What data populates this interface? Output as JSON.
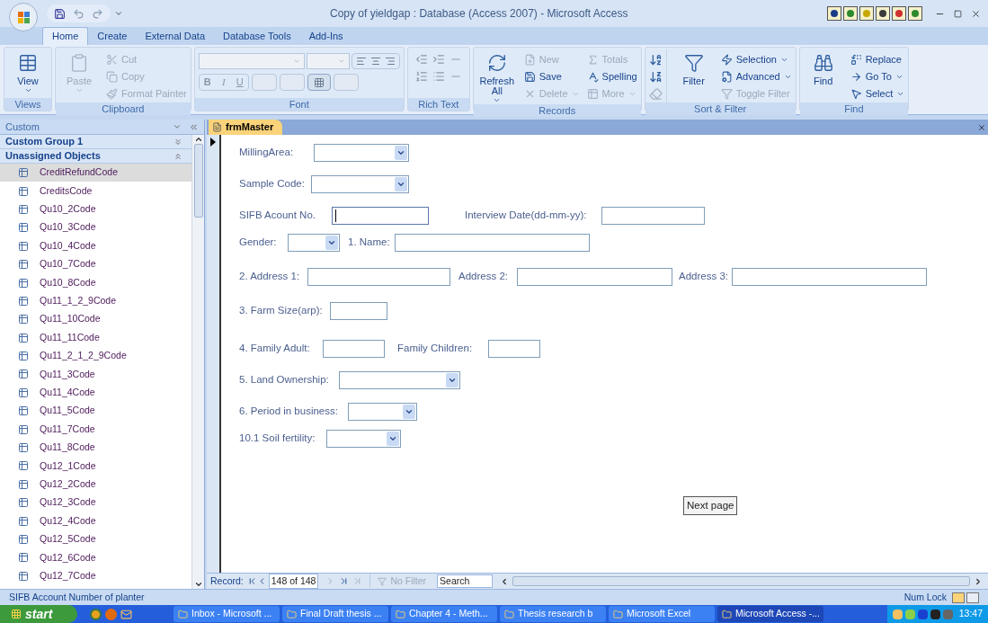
{
  "window": {
    "title": "Copy of yieldgap : Database (Access 2007) - Microsoft Access"
  },
  "ribbon_tabs": [
    {
      "label": "Home",
      "selected": true
    },
    {
      "label": "Create",
      "selected": false
    },
    {
      "label": "External Data",
      "selected": false
    },
    {
      "label": "Database Tools",
      "selected": false
    },
    {
      "label": "Add-Ins",
      "selected": false
    }
  ],
  "ribbon_groups": [
    {
      "kind": "commands",
      "label": "Views",
      "items": [
        {
          "label": "View",
          "kind": "large",
          "disabled": false,
          "dropdown": true
        }
      ]
    },
    {
      "kind": "commands",
      "label": "Clipboard",
      "items": [
        {
          "label": "Paste",
          "kind": "large",
          "disabled": true,
          "dropdown": true
        },
        {
          "label": "Cut",
          "kind": "small",
          "disabled": true,
          "dropdown": false
        },
        {
          "label": "Copy",
          "kind": "small",
          "disabled": true,
          "dropdown": false
        },
        {
          "label": "Format Painter",
          "kind": "small",
          "disabled": true,
          "dropdown": false
        }
      ]
    },
    {
      "kind": "font",
      "label": "Font",
      "format_buttons": [
        "B",
        "I",
        "U"
      ]
    },
    {
      "kind": "richtext",
      "label": "Rich Text"
    },
    {
      "kind": "commands",
      "label": "Records",
      "items": [
        {
          "label": "Refresh All",
          "kind": "large",
          "disabled": false,
          "dropdown": true
        },
        {
          "label": "New",
          "kind": "small",
          "disabled": true,
          "dropdown": false
        },
        {
          "label": "Save",
          "kind": "small",
          "disabled": false,
          "dropdown": false
        },
        {
          "label": "Delete",
          "kind": "small",
          "disabled": true,
          "dropdown": true
        },
        {
          "label": "Totals",
          "kind": "small",
          "disabled": true,
          "dropdown": false
        },
        {
          "label": "Spelling",
          "kind": "small",
          "disabled": false,
          "dropdown": false
        },
        {
          "label": "More",
          "kind": "small",
          "disabled": true,
          "dropdown": true
        }
      ]
    },
    {
      "kind": "sortfilter",
      "label": "Sort & Filter",
      "items": [
        {
          "label": "Filter",
          "kind": "large",
          "disabled": false,
          "dropdown": false
        },
        {
          "label": "Selection",
          "kind": "small",
          "disabled": false,
          "dropdown": true
        },
        {
          "label": "Advanced",
          "kind": "small",
          "disabled": false,
          "dropdown": true
        },
        {
          "label": "Toggle Filter",
          "kind": "small",
          "disabled": true,
          "dropdown": false
        }
      ]
    },
    {
      "kind": "commands",
      "label": "Find",
      "items": [
        {
          "label": "Find",
          "kind": "large",
          "disabled": false,
          "dropdown": false
        },
        {
          "label": "Replace",
          "kind": "small",
          "disabled": false,
          "dropdown": false
        },
        {
          "label": "Go To",
          "kind": "small",
          "disabled": false,
          "dropdown": true
        },
        {
          "label": "Select",
          "kind": "small",
          "disabled": false,
          "dropdown": true
        }
      ]
    }
  ],
  "nav_pane": {
    "title": "Custom",
    "groups": [
      {
        "label": "Custom Group 1",
        "expanded": false
      },
      {
        "label": "Unassigned Objects",
        "expanded": true,
        "items": [
          {
            "label": "CreditRefundCode",
            "selected": true
          },
          {
            "label": "CreditsCode",
            "selected": false
          },
          {
            "label": "Qu10_2Code",
            "selected": false
          },
          {
            "label": "Qu10_3Code",
            "selected": false
          },
          {
            "label": "Qu10_4Code",
            "selected": false
          },
          {
            "label": "Qu10_7Code",
            "selected": false
          },
          {
            "label": "Qu10_8Code",
            "selected": false
          },
          {
            "label": "Qu11_1_2_9Code",
            "selected": false
          },
          {
            "label": "Qu11_10Code",
            "selected": false
          },
          {
            "label": "Qu11_11Code",
            "selected": false
          },
          {
            "label": "Qu11_2_1_2_9Code",
            "selected": false
          },
          {
            "label": "Qu11_3Code",
            "selected": false
          },
          {
            "label": "Qu11_4Code",
            "selected": false
          },
          {
            "label": "Qu11_5Code",
            "selected": false
          },
          {
            "label": "Qu11_7Code",
            "selected": false
          },
          {
            "label": "Qu11_8Code",
            "selected": false
          },
          {
            "label": "Qu12_1Code",
            "selected": false
          },
          {
            "label": "Qu12_2Code",
            "selected": false
          },
          {
            "label": "Qu12_3Code",
            "selected": false
          },
          {
            "label": "Qu12_4Code",
            "selected": false
          },
          {
            "label": "Qu12_5Code",
            "selected": false
          },
          {
            "label": "Qu12_6Code",
            "selected": false
          },
          {
            "label": "Qu12_7Code",
            "selected": false
          }
        ]
      }
    ]
  },
  "document_tab": {
    "label": "frmMaster",
    "selected": true
  },
  "form": {
    "rows": [
      [
        {
          "kind": "label",
          "text": "MillingArea:"
        },
        {
          "kind": "combo"
        }
      ],
      [
        {
          "kind": "label",
          "text": "Sample Code:"
        },
        {
          "kind": "combo"
        }
      ],
      [
        {
          "kind": "label",
          "text": "SIFB Acount No."
        },
        {
          "kind": "text",
          "focused": true
        },
        {
          "kind": "label",
          "text": "Interview Date(dd-mm-yy):"
        },
        {
          "kind": "text",
          "focused": false
        }
      ],
      [
        {
          "kind": "label",
          "text": "Gender:"
        },
        {
          "kind": "combo"
        },
        {
          "kind": "label",
          "text": "1. Name:"
        },
        {
          "kind": "text",
          "focused": false
        }
      ],
      [
        {
          "kind": "label",
          "text": "2. Address 1:"
        },
        {
          "kind": "text",
          "focused": false
        },
        {
          "kind": "label",
          "text": "Address 2:"
        },
        {
          "kind": "text",
          "focused": false
        },
        {
          "kind": "label",
          "text": "Address 3:"
        },
        {
          "kind": "text",
          "focused": false
        }
      ],
      [
        {
          "kind": "label",
          "text": "3. Farm Size(arp):"
        },
        {
          "kind": "text",
          "focused": false
        }
      ],
      [
        {
          "kind": "label",
          "text": "4. Family Adult:"
        },
        {
          "kind": "text",
          "focused": false
        },
        {
          "kind": "label",
          "text": "Family Children:"
        },
        {
          "kind": "text",
          "focused": false
        }
      ],
      [
        {
          "kind": "label",
          "text": "5. Land Ownership:"
        },
        {
          "kind": "combo"
        }
      ],
      [
        {
          "kind": "label",
          "text": "6. Period in business:"
        },
        {
          "kind": "combo"
        }
      ],
      [
        {
          "kind": "label",
          "text": "10.1 Soil fertility:"
        },
        {
          "kind": "combo"
        }
      ]
    ],
    "button": "Next page"
  },
  "record_nav": {
    "label": "Record:",
    "position": "148 of 148",
    "filter": "No Filter",
    "search_placeholder": "Search"
  },
  "status_bar": {
    "message": "SIFB Account Number of planter",
    "indicator": "Num Lock"
  },
  "taskbar": {
    "start": "start",
    "tasks": [
      {
        "label": "Inbox - Microsoft ...",
        "selected": false
      },
      {
        "label": "Final Draft thesis ...",
        "selected": false
      },
      {
        "label": "Chapter 4 - Meth...",
        "selected": false
      },
      {
        "label": "Thesis research b",
        "selected": false
      },
      {
        "label": "Microsoft Excel",
        "selected": false
      },
      {
        "label": "Microsoft Access -...",
        "selected": true
      }
    ],
    "clock": "13:47"
  }
}
